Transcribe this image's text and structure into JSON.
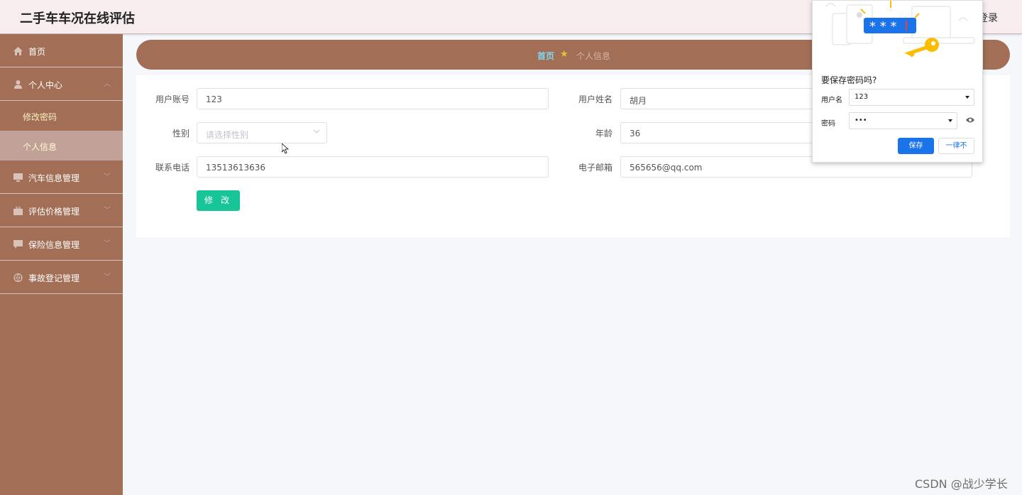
{
  "header": {
    "title": "二手车车况在线评估",
    "login_partial": "登录"
  },
  "sidebar": {
    "items": [
      {
        "label": "首页",
        "icon": "home-icon"
      },
      {
        "label": "个人中心",
        "icon": "user-icon",
        "arrow": "︿"
      },
      {
        "label": "汽车信息管理",
        "icon": "monitor-icon",
        "arrow": "﹀"
      },
      {
        "label": "评估价格管理",
        "icon": "briefcase-icon",
        "arrow": "﹀"
      },
      {
        "label": "保险信息管理",
        "icon": "chat-icon",
        "arrow": "﹀"
      },
      {
        "label": "事故登记管理",
        "icon": "globe-icon",
        "arrow": "﹀"
      }
    ],
    "subitems": [
      {
        "label": "修改密码"
      },
      {
        "label": "个人信息"
      }
    ]
  },
  "breadcrumb": {
    "home": "首页",
    "current": "个人信息"
  },
  "form": {
    "account_label": "用户账号",
    "account_value": "123",
    "name_label": "用户姓名",
    "name_value": "胡月",
    "gender_label": "性别",
    "gender_placeholder": "请选择性别",
    "age_label": "年龄",
    "age_value": "36",
    "phone_label": "联系电话",
    "phone_value": "13513613636",
    "email_label": "电子邮箱",
    "email_value": "565656@qq.com",
    "modify_button": "修 改"
  },
  "password_popup": {
    "title": "要保存密码吗?",
    "username_label": "用户名",
    "username_value": "123",
    "password_label": "密码",
    "password_value": "•••",
    "save_button": "保存",
    "never_button": "一律不",
    "stars": "* * *"
  },
  "watermark": "CSDN @战少学长",
  "colors": {
    "sidebar": "#a26f56",
    "header": "#f7ecee",
    "accent_button": "#18c598",
    "save_button": "#1a73e8"
  }
}
